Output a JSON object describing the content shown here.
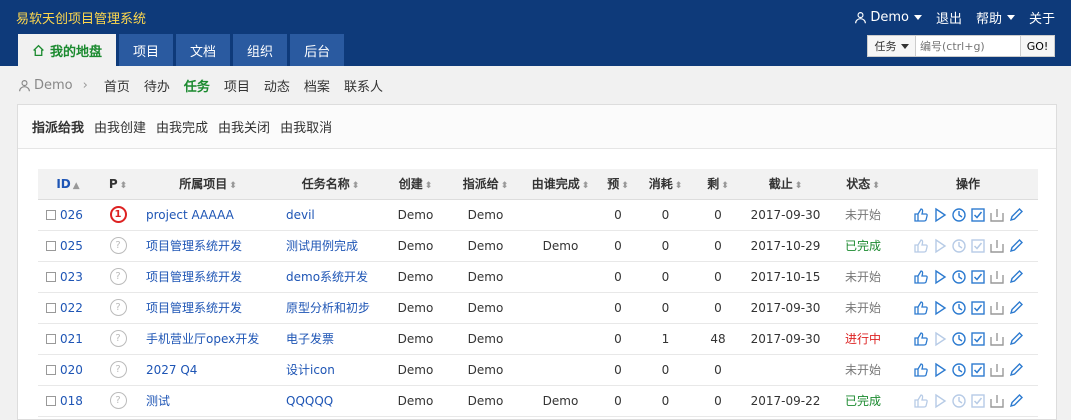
{
  "app_title": "易软天创项目管理系统",
  "top_right": {
    "user": "Demo",
    "logout": "退出",
    "help": "帮助",
    "about": "关于"
  },
  "nav_tabs": [
    {
      "label": "我的地盘",
      "active": true
    },
    {
      "label": "项目"
    },
    {
      "label": "文档"
    },
    {
      "label": "组织"
    },
    {
      "label": "后台"
    }
  ],
  "search": {
    "type_label": "任务",
    "placeholder": "编号(ctrl+g)",
    "go_label": "GO!"
  },
  "breadcrumb": {
    "user": "Demo"
  },
  "subnav": [
    "首页",
    "待办",
    "任务",
    "项目",
    "动态",
    "档案",
    "联系人"
  ],
  "subnav_active": "任务",
  "filters": [
    "指派给我",
    "由我创建",
    "由我完成",
    "由我关闭",
    "由我取消"
  ],
  "filter_active": "指派给我",
  "columns": [
    "ID",
    "P",
    "所属项目",
    "任务名称",
    "创建",
    "指派给",
    "由谁完成",
    "预",
    "消耗",
    "剩",
    "截止",
    "状态",
    "操作"
  ],
  "rows": [
    {
      "id": "026",
      "pri": "1",
      "project": "project AAAAA",
      "task": "devil",
      "creator": "Demo",
      "assigned": "Demo",
      "finished_by": "",
      "est": "0",
      "consumed": "0",
      "left": "0",
      "deadline": "2017-09-30",
      "status": "未开始",
      "status_type": "wait"
    },
    {
      "id": "025",
      "pri": "?",
      "project": "项目管理系统开发",
      "task": "测试用例完成",
      "creator": "Demo",
      "assigned": "Demo",
      "finished_by": "Demo",
      "est": "0",
      "consumed": "0",
      "left": "0",
      "deadline": "2017-10-29",
      "status": "已完成",
      "status_type": "done"
    },
    {
      "id": "023",
      "pri": "?",
      "project": "项目管理系统开发",
      "task": "demo系统开发",
      "creator": "Demo",
      "assigned": "Demo",
      "finished_by": "",
      "est": "0",
      "consumed": "0",
      "left": "0",
      "deadline": "2017-10-15",
      "status": "未开始",
      "status_type": "wait"
    },
    {
      "id": "022",
      "pri": "?",
      "project": "项目管理系统开发",
      "task": "原型分析和初步",
      "creator": "Demo",
      "assigned": "Demo",
      "finished_by": "",
      "est": "0",
      "consumed": "0",
      "left": "0",
      "deadline": "2017-09-30",
      "status": "未开始",
      "status_type": "wait"
    },
    {
      "id": "021",
      "pri": "?",
      "project": "手机营业厅opex开发",
      "task": "电子发票",
      "creator": "Demo",
      "assigned": "Demo",
      "finished_by": "",
      "est": "0",
      "consumed": "1",
      "left": "48",
      "deadline": "2017-09-30",
      "status": "进行中",
      "status_type": "doing"
    },
    {
      "id": "020",
      "pri": "?",
      "project": "2027 Q4",
      "task": "设计icon",
      "creator": "Demo",
      "assigned": "Demo",
      "finished_by": "",
      "est": "0",
      "consumed": "0",
      "left": "0",
      "deadline": "",
      "status": "未开始",
      "status_type": "wait"
    },
    {
      "id": "018",
      "pri": "?",
      "project": "测试",
      "task": "QQQQQ",
      "creator": "Demo",
      "assigned": "Demo",
      "finished_by": "Demo",
      "est": "0",
      "consumed": "0",
      "left": "0",
      "deadline": "2017-09-22",
      "status": "已完成",
      "status_type": "done"
    }
  ],
  "colors": {
    "header_bg": "#0e3a7a",
    "title": "#ffd84d",
    "link": "#1e55b5",
    "active_green": "#1b8a2f",
    "danger": "#d22"
  }
}
